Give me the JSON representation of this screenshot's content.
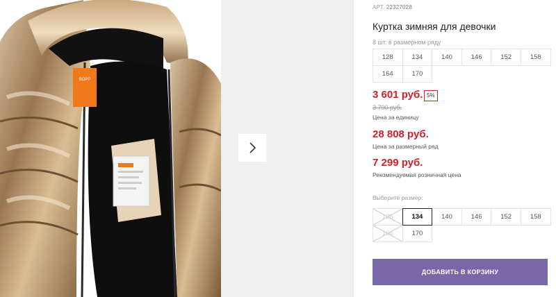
{
  "product": {
    "sku_label": "АРТ.",
    "sku": "22327028",
    "title": "Куртка зимняя для девочки",
    "row_note": "8 шт. в размерном ряду",
    "row_sizes": [
      "128",
      "134",
      "140",
      "146",
      "152",
      "158",
      "164",
      "170"
    ],
    "price_unit": "3 601 руб.",
    "discount": "5%",
    "old_price": "3 790 руб.",
    "price_unit_caption": "Цена за единицу",
    "price_row": "28 808 руб.",
    "price_row_caption": "Цена за размерный ряд",
    "price_retail": "7 299 руб.",
    "price_retail_caption": "Рекомендуемая розничная цена",
    "select_size_label": "Выберите размер:",
    "select_sizes": [
      {
        "label": "128",
        "state": "disabled"
      },
      {
        "label": "134",
        "state": "selected"
      },
      {
        "label": "140",
        "state": "available"
      },
      {
        "label": "146",
        "state": "available"
      },
      {
        "label": "152",
        "state": "available"
      },
      {
        "label": "158",
        "state": "available"
      },
      {
        "label": "164",
        "state": "disabled"
      },
      {
        "label": "170",
        "state": "available"
      }
    ],
    "add_to_cart": "ДОБАВИТЬ В КОРЗИНУ"
  },
  "gallery": {
    "next_icon": "chevron-right-icon",
    "label_brand": "BOPP",
    "label_tag": "playtoday"
  },
  "colors": {
    "price": "#d32027",
    "button": "#7a67a8",
    "jacket": "#b8946a"
  }
}
